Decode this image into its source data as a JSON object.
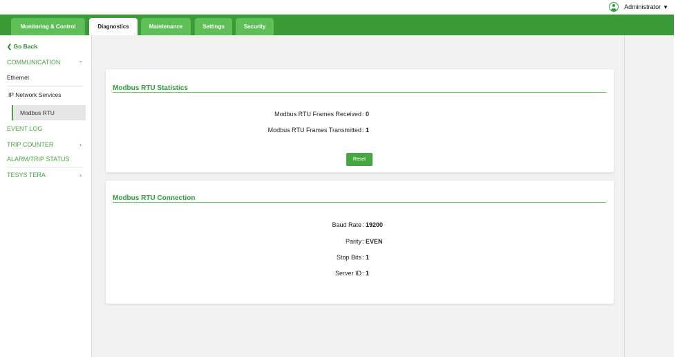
{
  "user": {
    "name": "Administrator",
    "caret": "▼",
    "icon": "user-circle-icon"
  },
  "tabs": [
    {
      "label": "Monitoring & Control",
      "active": false
    },
    {
      "label": "Diagnostics",
      "active": true
    },
    {
      "label": "Maintenance",
      "active": false
    },
    {
      "label": "Settings",
      "active": false
    },
    {
      "label": "Security",
      "active": false
    }
  ],
  "sidebar": {
    "go_back": "❮ Go Back",
    "communication": {
      "label": "COMMUNICATION",
      "chevron": "⌄"
    },
    "sub_items": [
      "Ethernet",
      "IP Network Services",
      "Modbus RTU"
    ],
    "event_log": "EVENT LOG",
    "trip_counter": {
      "label": "TRIP COUNTER",
      "chevron": "›"
    },
    "alarm_trip_status": "ALARM/TRIP STATUS",
    "tesys_tera": {
      "label": "TESYS TERA",
      "chevron": "›"
    }
  },
  "statistics": {
    "title": "Modbus RTU Statistics",
    "rows": [
      {
        "label": "Modbus RTU Frames Received",
        "value": "0"
      },
      {
        "label": "Modbus RTU Frames Transmitted",
        "value": "1"
      }
    ],
    "reset_label": "Reset"
  },
  "connection": {
    "title": "Modbus RTU Connection",
    "rows": [
      {
        "label": "Baud Rate",
        "value": "19200"
      },
      {
        "label": "Parity",
        "value": "EVEN"
      },
      {
        "label": "Stop Bits",
        "value": "1"
      },
      {
        "label": "Server ID",
        "value": "1"
      }
    ]
  },
  "colors": {
    "brand_green": "#3a9b36",
    "tab_green": "#5fbf57",
    "accent_text": "#2e9a3a"
  }
}
